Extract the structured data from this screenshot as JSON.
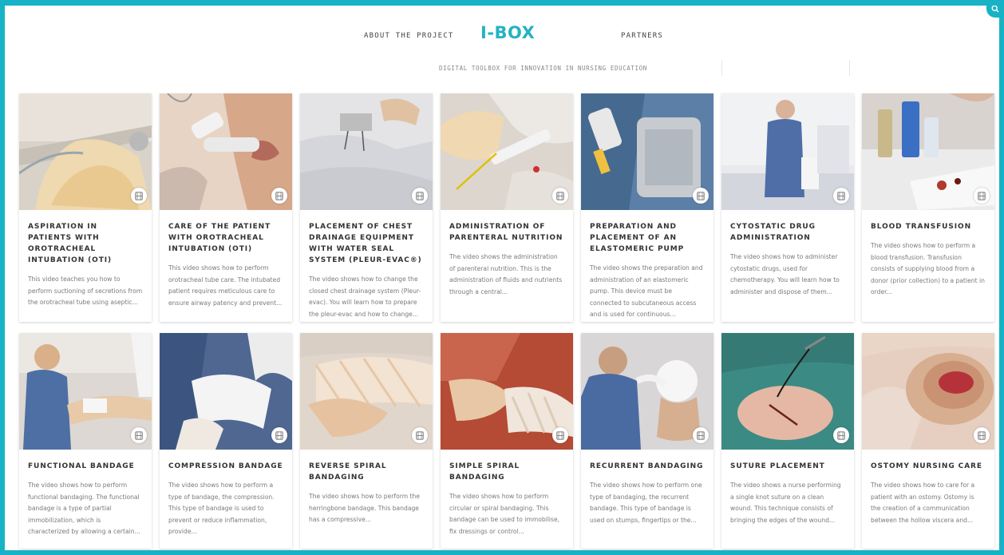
{
  "header": {
    "nav_about": "ABOUT THE PROJECT",
    "logo": "I-BOX",
    "nav_partners": "PARTNERS",
    "tagline": "DIGITAL TOOLBOX FOR INNOVATION IN NURSING EDUCATION"
  },
  "colors": {
    "accent": "#17b2c6",
    "logo": "#24b3c2"
  },
  "icons": {
    "corner": "search-icon",
    "card_badge": "film-icon"
  },
  "cards": [
    {
      "title": "ASPIRATION IN PATIENTS WITH OROTRACHEAL INTUBATION (OTI)",
      "desc": "This video teaches you how to perform suctioning of secretions from the orotracheal tube using aseptic..."
    },
    {
      "title": "CARE OF THE PATIENT WITH OROTRACHEAL INTUBATION (OTI)",
      "desc": "This video shows how to perform orotracheal tube care. The intubated patient requires meticulous care to ensure airway patency and prevent..."
    },
    {
      "title": "PLACEMENT OF CHEST DRAINAGE EQUIPMENT WITH WATER SEAL SYSTEM (PLEUR-EVAC®)",
      "desc": "The video shows how to change the closed chest drainage system (Pleur-evac). You will learn how to prepare the pleur-evac and how to change..."
    },
    {
      "title": "ADMINISTRATION OF PARENTERAL NUTRITION",
      "desc": "The video shows the administration of parenteral nutrition. This is the administration of fluids and nutrients through a central..."
    },
    {
      "title": "PREPARATION AND PLACEMENT OF AN ELASTOMERIC PUMP",
      "desc": "The video shows the preparation and administration of an elastomeric pump. This device must be connected to subcutaneous access and is used for continuous..."
    },
    {
      "title": "CYTOSTATIC DRUG ADMINISTRATION",
      "desc": "The video shows how to administer cytostatic drugs, used for chemotherapy. You will learn how to administer and dispose of them..."
    },
    {
      "title": "BLOOD TRANSFUSION",
      "desc": "The video shows how to perform a blood transfusion. Transfusion consists of supplying blood from a donor (prior collection) to a patient in order..."
    },
    {
      "title": "FUNCTIONAL BANDAGE",
      "desc": "The video shows how to perform functional bandaging. The functional bandage is a type of partial immobilization, which is characterized by allowing a certain..."
    },
    {
      "title": "COMPRESSION BANDAGE",
      "desc": "The video shows how to perform a type of bandage, the compression. This type of bandage is used to prevent or reduce inflammation, provide..."
    },
    {
      "title": "REVERSE SPIRAL BANDAGING",
      "desc": "The video shows how to perform the herringbone bandage. This bandage has a compressive..."
    },
    {
      "title": "SIMPLE SPIRAL BANDAGING",
      "desc": "The video shows how to perform circular or spiral bandaging. This bandage can be used to immobilise, fix dressings or control..."
    },
    {
      "title": "RECURRENT BANDAGING",
      "desc": "The video shows how to perform one type of bandaging, the recurrent bandage. This type of bandage is used on stumps, fingertips or the..."
    },
    {
      "title": "SUTURE PLACEMENT",
      "desc": "The video shows a nurse performing a single knot suture on a clean wound. This technique consists of bringing the edges of the wound..."
    },
    {
      "title": "OSTOMY NURSING CARE",
      "desc": "The video shows how to care for a patient with an ostomy. Ostomy is the creation of a communication between the hollow viscera and..."
    }
  ]
}
